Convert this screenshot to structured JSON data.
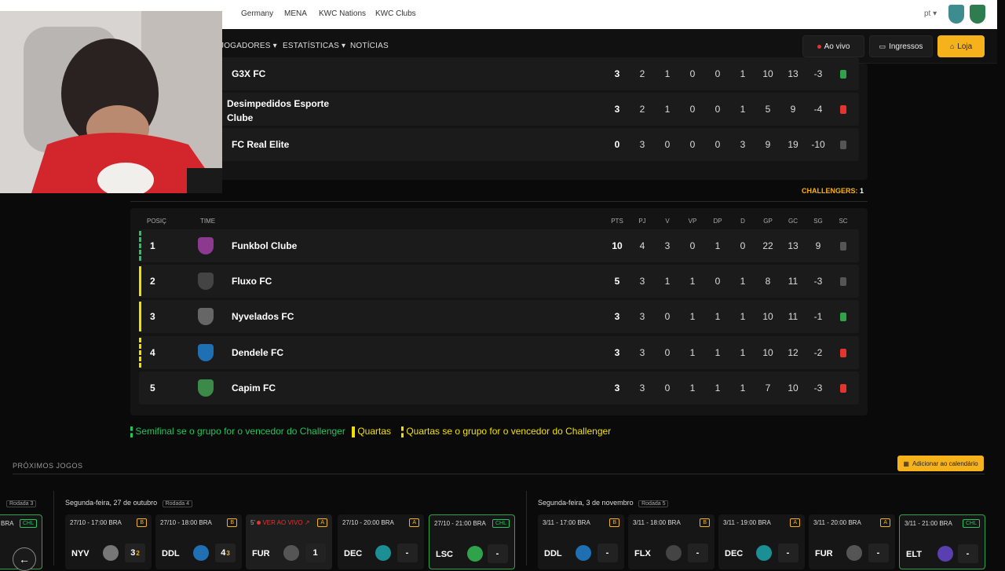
{
  "topbar": {
    "links": [
      "Germany",
      "MENA",
      "KWC Nations",
      "KWC Clubs"
    ],
    "lang": "pt"
  },
  "nav": {
    "links": [
      "JOGADORES",
      "ESTATÍSTICAS",
      "NOTÍCIAS"
    ],
    "live_label": "Ao vivo",
    "tickets_label": "Ingressos",
    "shop_label": "Loja"
  },
  "upper_rows": [
    {
      "team": "G3X FC",
      "stats": [
        "3",
        "2",
        "1",
        "0",
        "0",
        "1",
        "10",
        "13",
        "-3"
      ],
      "form_color": "#2fa34a"
    },
    {
      "team": "Desimpedidos Esporte Clube",
      "stats": [
        "3",
        "2",
        "1",
        "0",
        "0",
        "1",
        "5",
        "9",
        "-4"
      ],
      "form_color": "#e3342f"
    },
    {
      "team": "FC Real Elite",
      "stats": [
        "0",
        "3",
        "0",
        "0",
        "0",
        "3",
        "9",
        "19",
        "-10"
      ],
      "form_color": "#555555"
    }
  ],
  "challengers_label": "CHALLENGERS:",
  "challengers_value": "1",
  "table_headers": {
    "pos": "POSIÇ",
    "team": "TIME",
    "cols": [
      "PTS",
      "PJ",
      "V",
      "VP",
      "DP",
      "D",
      "GP",
      "GC",
      "SG",
      "SC"
    ]
  },
  "rows": [
    {
      "pos": "1",
      "team": "Funkbol Clube",
      "stats": [
        "10",
        "4",
        "3",
        "0",
        "1",
        "0",
        "22",
        "13",
        "9"
      ],
      "form_color": "#555555",
      "crest_color": "#8b3a8f",
      "mark": "dashed-green"
    },
    {
      "pos": "2",
      "team": "Fluxo FC",
      "stats": [
        "5",
        "3",
        "1",
        "1",
        "0",
        "1",
        "8",
        "11",
        "-3"
      ],
      "form_color": "#555555",
      "crest_color": "#444444",
      "mark": "yellow"
    },
    {
      "pos": "3",
      "team": "Nyvelados FC",
      "stats": [
        "3",
        "3",
        "0",
        "1",
        "1",
        "1",
        "10",
        "11",
        "-1"
      ],
      "form_color": "#2fa34a",
      "crest_color": "#666666",
      "mark": "yellow"
    },
    {
      "pos": "4",
      "team": "Dendele FC",
      "stats": [
        "3",
        "3",
        "0",
        "1",
        "1",
        "1",
        "10",
        "12",
        "-2"
      ],
      "form_color": "#e3342f",
      "crest_color": "#1f6fb3",
      "mark": "dashed-yellow"
    },
    {
      "pos": "5",
      "team": "Capim FC",
      "stats": [
        "3",
        "3",
        "0",
        "1",
        "1",
        "1",
        "7",
        "10",
        "-3"
      ],
      "form_color": "#e3342f",
      "crest_color": "#3b8a4a",
      "mark": "none"
    }
  ],
  "legend": {
    "semifinal": "Semifinal se o grupo for o vencedor do Challenger",
    "quartas": "Quartas",
    "quartas_cond": "Quartas se o grupo for o vencedor do Challenger"
  },
  "upcoming": {
    "title": "PRÓXIMOS JOGOS",
    "calendar_label": "Adicionar ao calendário",
    "day1": "Segunda-feira, 27 de outubro",
    "day1_round": "Rodada 4",
    "day2": "Segunda-feira, 3 de novembro",
    "day2_round": "Rodada 5",
    "prev_round": "Rodada 3",
    "prev_tag": "CHL",
    "prev_team": "BRA",
    "live_label": "VER AO VIVO",
    "live_minute": "5'",
    "cards": [
      {
        "date": "27/10 - 17:00 BRA",
        "tag": "B",
        "team": "NYV",
        "score": "3",
        "score2": "2",
        "logo": "#777777"
      },
      {
        "date": "27/10 - 18:00 BRA",
        "tag": "B",
        "team": "DDL",
        "score": "4",
        "score2": "3",
        "logo": "#1f6fb3"
      },
      {
        "date": "",
        "tag": "A",
        "team": "FUR",
        "score": "1",
        "score2": "",
        "logo": "#555555"
      },
      {
        "date": "27/10 - 20:00 BRA",
        "tag": "A",
        "team": "DEC",
        "score": "-",
        "score2": "",
        "logo": "#1c8f95"
      },
      {
        "date": "27/10 - 21:00 BRA",
        "tag": "CHL",
        "team": "LSC",
        "score": "-",
        "score2": "",
        "logo": "#2fa34a"
      },
      {
        "date": "3/11 - 17:00 BRA",
        "tag": "B",
        "team": "DDL",
        "score": "-",
        "score2": "",
        "logo": "#1f6fb3"
      },
      {
        "date": "3/11 - 18:00 BRA",
        "tag": "B",
        "team": "FLX",
        "score": "-",
        "score2": "",
        "logo": "#444444"
      },
      {
        "date": "3/11 - 19:00 BRA",
        "tag": "A",
        "team": "DEC",
        "score": "-",
        "score2": "",
        "logo": "#1c8f95"
      },
      {
        "date": "3/11 - 20:00 BRA",
        "tag": "A",
        "team": "FUR",
        "score": "-",
        "score2": "",
        "logo": "#555555"
      },
      {
        "date": "3/11 - 21:00 BRA",
        "tag": "CHL",
        "team": "ELT",
        "score": "-",
        "score2": "",
        "logo": "#5a3fb0"
      }
    ]
  }
}
